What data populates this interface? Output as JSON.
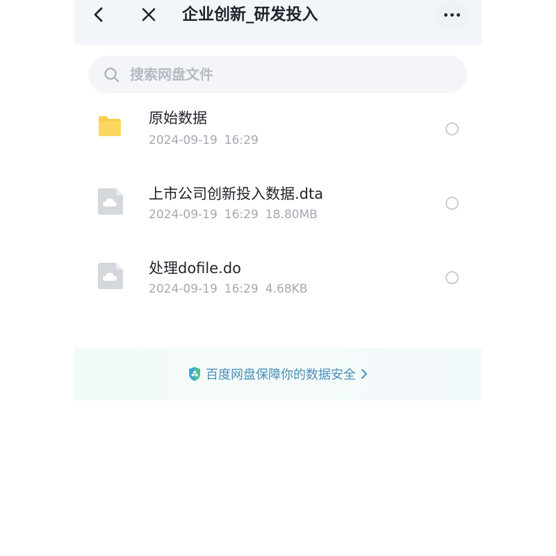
{
  "header": {
    "title": "企业创新_研发投入",
    "back_icon": "chevron-left-icon",
    "close_icon": "close-icon",
    "more_icon": "more-horizontal-icon"
  },
  "search": {
    "placeholder": "搜索网盘文件",
    "value": ""
  },
  "files": [
    {
      "name": "原始数据",
      "date": "2024-09-19",
      "time": "16:29",
      "size": "",
      "icon": "folder-icon"
    },
    {
      "name": "上市公司创新投入数据.dta",
      "date": "2024-09-19",
      "time": "16:29",
      "size": "18.80MB",
      "icon": "cloud-file-icon"
    },
    {
      "name": "处理dofile.do",
      "date": "2024-09-19",
      "time": "16:29",
      "size": "4.68KB",
      "icon": "cloud-file-icon"
    }
  ],
  "security_banner": {
    "text": "百度网盘保障你的数据安全",
    "icon": "shield-icon"
  },
  "colors": {
    "topbar_bg": "#f2f5fa",
    "folder": "#f9cf4a",
    "banner_text": "#4a8fb8",
    "meta_text": "#a3a8b0"
  }
}
